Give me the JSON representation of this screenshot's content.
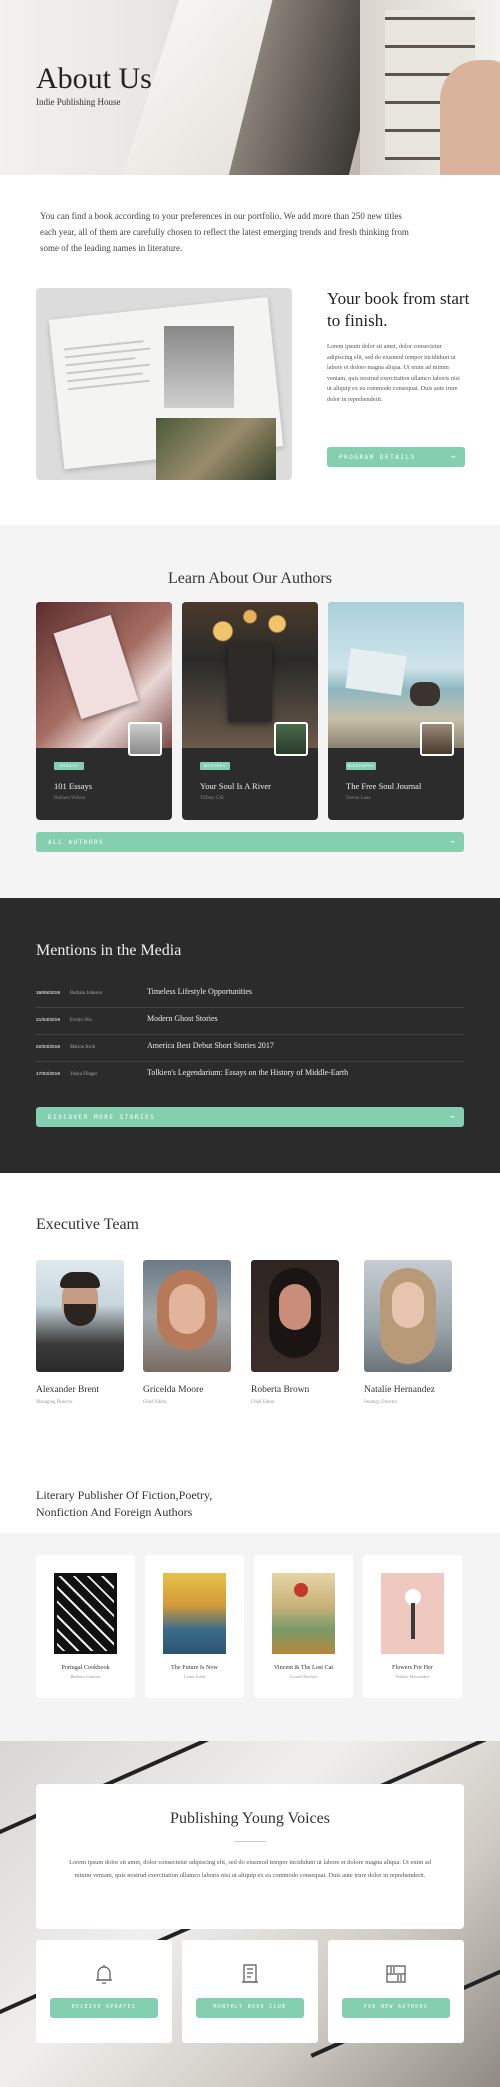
{
  "hero": {
    "title": "About Us",
    "subtitle": "Indie Publishing House"
  },
  "intro": {
    "text": "You can find a book according to your preferences in our portfolio. We add more than 250 new titles each year, all of them are carefully chosen to reflect the latest emerging trends and fresh thinking from some of the leading names in literature."
  },
  "feature": {
    "title": "Your book from start to finish.",
    "body": "Lorem ipsum dolor sit amet, dolor consectetur adipiscing elit, sed do eiusmod tempor incididunt ut labore et dolore magna aliqua. Ut enim ad minim veniam, quis nostrud exercitation ullamco laboris nisi ut aliquip ex ea commodo consequat. Duis aute irure dolor in reprehenderit.",
    "button": "PROGRAM DETAILS",
    "arrow": "→"
  },
  "authors": {
    "title": "Learn About Our Authors",
    "cards": [
      {
        "tag": "ESSAYS",
        "title": "101 Essays",
        "author": "Barbara Wilson"
      },
      {
        "tag": "MYSTERY",
        "title": "Your Soul Is A River",
        "author": "Tiffany Gill"
      },
      {
        "tag": "BIOGRAPHY",
        "title": "The Free Soul Journal",
        "author": "Devon Lane"
      }
    ],
    "button": "ALL AUTHORS",
    "arrow": "→"
  },
  "media": {
    "title": "Mentions in the Media",
    "rows": [
      {
        "date": "18/05/2019",
        "author": "Barbara Johnson",
        "title": "Timeless Lifestyle Opportunities"
      },
      {
        "date": "21/04/2019",
        "author": "Evelyn Nix",
        "title": "Modern Ghost Stories"
      },
      {
        "date": "02/03/2019",
        "author": "Marion Krob",
        "title": "America Best Debut Short Stories 2017"
      },
      {
        "date": "17/02/2019",
        "author": "Yadya Flinger",
        "title": "Tolkien's Legendarium: Essays on the History of Middle-Earth"
      }
    ],
    "button": "DISCOVER MORE STORIES",
    "arrow": "→"
  },
  "team": {
    "title": "Executive Team",
    "members": [
      {
        "name": "Alexander Brent",
        "role": "Managing Director"
      },
      {
        "name": "Gricelda Moore",
        "role": "Chief Editor"
      },
      {
        "name": "Roberta Brown",
        "role": "Chief Editor"
      },
      {
        "name": "Natalie Hernandez",
        "role": "Strategy Director"
      }
    ]
  },
  "literary": {
    "title": "Literary Publisher Of Fiction,Poetry, Nonfiction And Foreign Authors",
    "books": [
      {
        "title": "Portugal Cookbook",
        "author": "Barbara Johnson"
      },
      {
        "title": "The Future Is Now",
        "author": "Laura Lobb"
      },
      {
        "title": "Vincent & The Lost Cat",
        "author": "Leonel Rechter"
      },
      {
        "title": "Flowers For Her",
        "author": "Natalie Hernandez"
      }
    ]
  },
  "publishing": {
    "title": "Publishing Young Voices",
    "body": "Lorem ipsum dolor sit amet, dolor consectetur adipiscing elit, sed do eiusmod tempor incididunt ut labore et dolore magna aliqua. Ut enim ad minim veniam, quis nostrud exercitation ullamco laboris nisi ut aliquip ex ea commodo consequat. Duis aute irure dolor in reprehenderit.",
    "cards": [
      {
        "icon": "bell-icon",
        "button": "RECEIVE UPDATES"
      },
      {
        "icon": "scroll-icon",
        "button": "MONTHLY BOOK CLUB"
      },
      {
        "icon": "bookshelf-icon",
        "button": "FOR NEW AUTHORS"
      }
    ]
  },
  "colors": {
    "accent": "#84cfb0",
    "dark": "#2b2b2b",
    "light_bg": "#f4f4f4"
  }
}
